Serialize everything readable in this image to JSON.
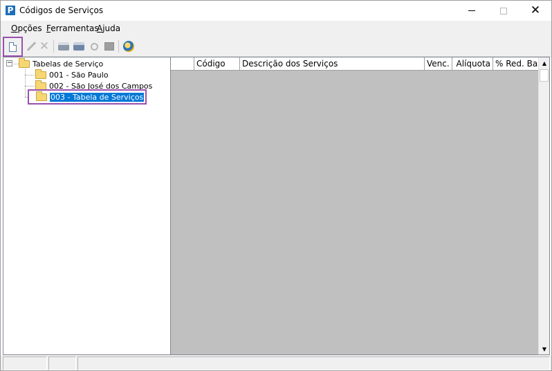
{
  "window": {
    "title": "Códigos de Serviços",
    "app_icon_letter": "P"
  },
  "menu": [
    {
      "accel": "O",
      "rest": "pções"
    },
    {
      "accel": "F",
      "rest": "erramentas"
    },
    {
      "accel": "A",
      "rest": "juda"
    }
  ],
  "toolbar": {
    "icons": [
      "new-document-icon",
      "edit-pencil-icon",
      "delete-x-icon",
      "printer-icon",
      "print-setup-icon",
      "search-magnifier-icon",
      "view-grid-icon",
      "web-update-icon"
    ],
    "delete_glyph": "✕",
    "highlight_color": "#9b4fb0"
  },
  "tree": {
    "expander_glyph": "−",
    "root_label": "Tabelas de Serviço",
    "items": [
      {
        "label": "001 - São Paulo"
      },
      {
        "label": "002 - São José dos Campos"
      },
      {
        "label": "003 - Tabela de Serviços",
        "selected": true
      }
    ]
  },
  "grid": {
    "columns": [
      {
        "label": ""
      },
      {
        "label": "Código"
      },
      {
        "label": "Descrição dos Serviços"
      },
      {
        "label": "Venc."
      },
      {
        "label": "Alíquota"
      },
      {
        "label": "% Red. Base"
      }
    ],
    "background_color": "#c0c0c0"
  },
  "scrollbar": {
    "up_glyph": "▲",
    "down_glyph": "▼"
  },
  "statusbar": {
    "panels": [
      "",
      "",
      ""
    ]
  }
}
